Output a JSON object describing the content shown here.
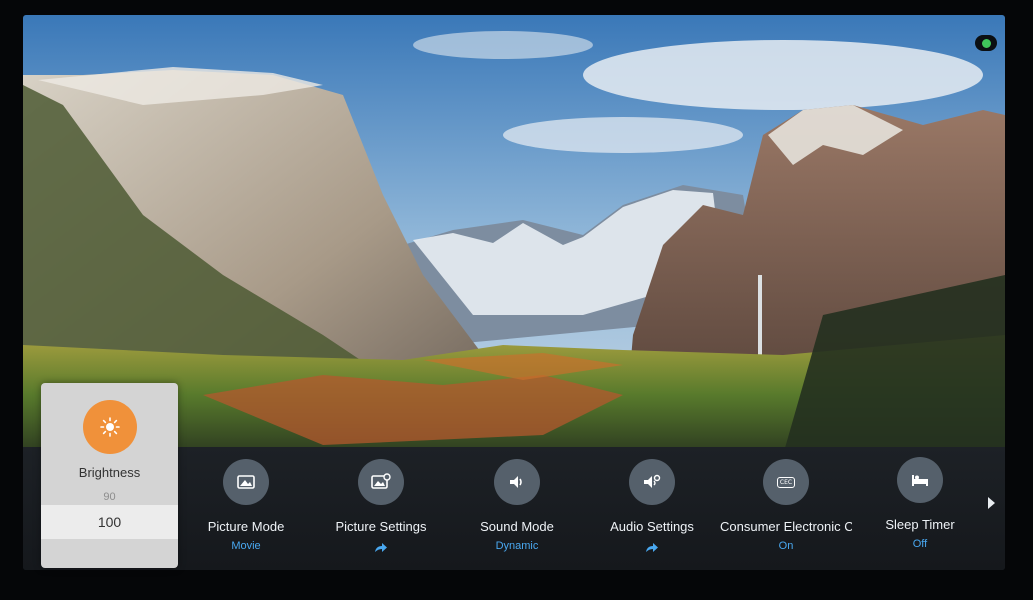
{
  "brightness": {
    "title": "Brightness",
    "previous_value": "90",
    "current_value": "100",
    "icon": "sun-icon",
    "accent_color": "#f0913a"
  },
  "menu": {
    "items": [
      {
        "label": "Picture Mode",
        "value": "Movie",
        "icon": "picture-icon"
      },
      {
        "label": "Picture Settings",
        "value": "",
        "icon": "picture-settings-icon",
        "arrow": true
      },
      {
        "label": "Sound Mode",
        "value": "Dynamic",
        "icon": "speaker-icon"
      },
      {
        "label": "Audio Settings",
        "value": "",
        "icon": "audio-settings-icon",
        "arrow": true
      },
      {
        "label": "Consumer Electronic C",
        "value": "On",
        "icon": "cec-icon",
        "icon_text": "CEC"
      },
      {
        "label": "Sleep Timer",
        "value": "Off",
        "icon": "bed-icon"
      }
    ],
    "value_color": "#49a8f0"
  }
}
